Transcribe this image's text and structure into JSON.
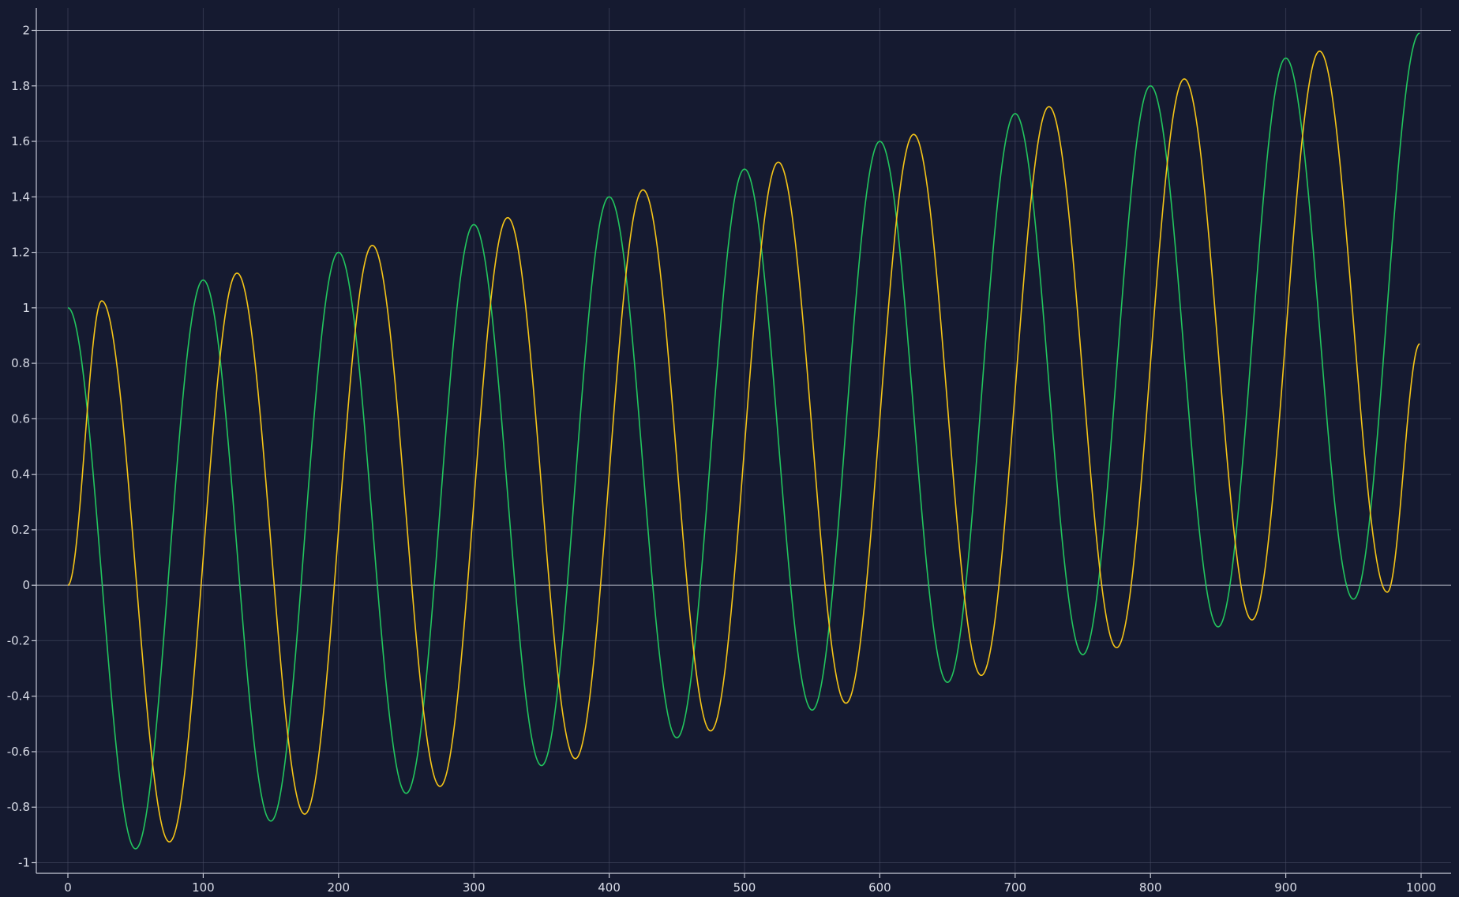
{
  "colors": {
    "background": "#151a30",
    "series_green": "#22c55e",
    "series_yellow": "#f5c518"
  },
  "chart_data": {
    "type": "line",
    "title": "",
    "xlabel": "",
    "ylabel": "",
    "xlim": [
      0,
      1000
    ],
    "ylim": [
      -1,
      2
    ],
    "x_ticks": [
      0,
      100,
      200,
      300,
      400,
      500,
      600,
      700,
      800,
      900,
      1000
    ],
    "x_tick_labels": [
      "0",
      "100",
      "200",
      "300",
      "400",
      "500",
      "600",
      "700",
      "800",
      "900",
      "1000"
    ],
    "y_ticks": [
      -1,
      -0.8,
      -0.6,
      -0.4,
      -0.2,
      0,
      0.2,
      0.4,
      0.6,
      0.8,
      1,
      1.2,
      1.4,
      1.6,
      1.8,
      2
    ],
    "y_tick_labels": [
      "-1",
      "-0.8",
      "-0.6",
      "-0.4",
      "-0.2",
      "0",
      "0.2",
      "0.4",
      "0.6",
      "0.8",
      "1",
      "1.2",
      "1.4",
      "1.6",
      "1.8",
      "2"
    ],
    "grid": true,
    "legend": "none",
    "series": [
      {
        "color": "#22c55e",
        "x": [
          0,
          50,
          100,
          150,
          200,
          250,
          300,
          350,
          400,
          450,
          500,
          550,
          600,
          650,
          700,
          750,
          800,
          850,
          900,
          950,
          999
        ],
        "y": [
          1.0,
          -0.95,
          1.1,
          -0.85,
          1.2,
          -0.75,
          1.3,
          -0.65,
          1.4,
          -0.55,
          1.5,
          -0.45,
          1.6,
          -0.35,
          1.7,
          -0.25,
          1.8,
          -0.15,
          1.9,
          -0.05,
          1.99
        ]
      },
      {
        "color": "#f5c518",
        "x": [
          0,
          25,
          75,
          125,
          175,
          225,
          275,
          325,
          375,
          425,
          475,
          525,
          575,
          625,
          675,
          725,
          775,
          825,
          875,
          925,
          975,
          999
        ],
        "y": [
          0.0,
          1.025,
          -0.925,
          1.125,
          -0.825,
          1.225,
          -0.725,
          1.325,
          -0.625,
          1.425,
          -0.525,
          1.525,
          -0.425,
          1.625,
          -0.325,
          1.725,
          -0.225,
          1.825,
          -0.125,
          1.925,
          -0.025,
          0.87
        ]
      }
    ]
  }
}
